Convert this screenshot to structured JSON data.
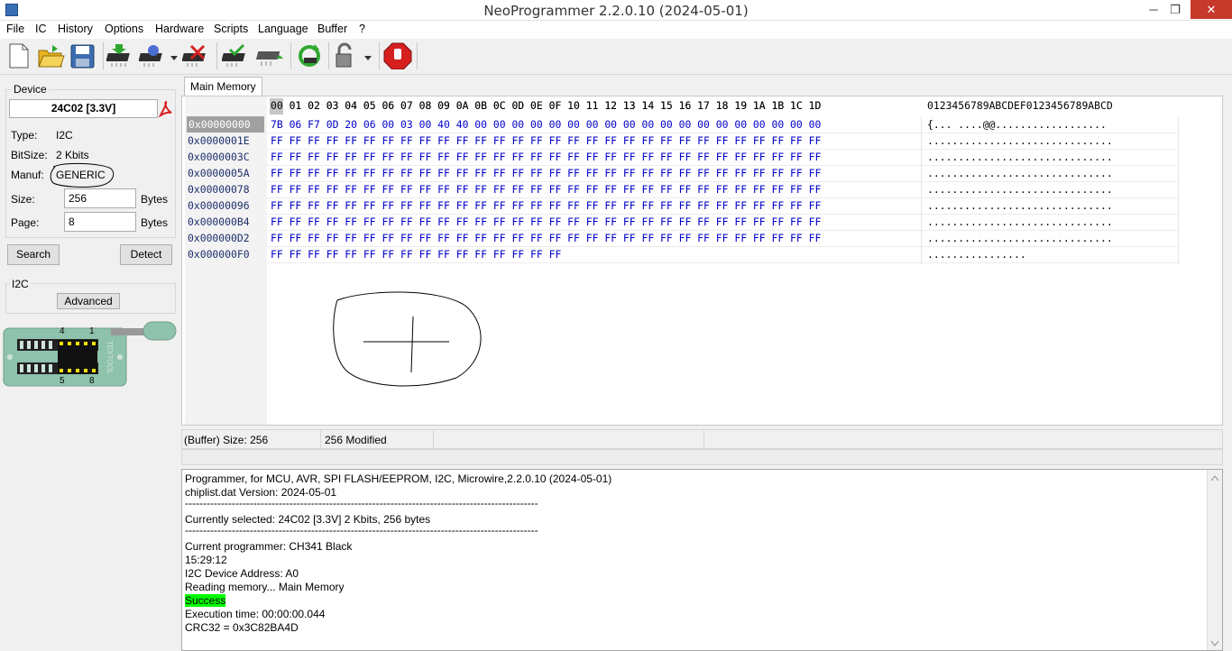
{
  "window": {
    "title": "NeoProgrammer 2.2.0.10 (2024-05-01)",
    "minimize": "─",
    "maximize": "❐",
    "close": "✕"
  },
  "menu": [
    "File",
    "IC",
    "History",
    "Options",
    "Hardware",
    "Scripts",
    "Language",
    "Buffer",
    "?"
  ],
  "toolbar": {
    "icons": [
      "new-file-icon",
      "open-folder-icon",
      "save-icon",
      "read-chip-icon",
      "write-chip-icon",
      "erase-chip-icon",
      "verify-chip-icon",
      "blank-check-icon",
      "auto-icon",
      "lock-icon",
      "stop-icon"
    ]
  },
  "device": {
    "group_title": "Device",
    "name": "24C02 [3.3V]",
    "type_label": "Type:",
    "type_value": "I2C",
    "bitsize_label": "BitSize:",
    "bitsize_value": "2 Kbits",
    "manuf_label": "Manuf:",
    "manuf_value": "GENERIC",
    "size_label": "Size:",
    "size_value": "256",
    "size_unit": "Bytes",
    "page_label": "Page:",
    "page_value": "8",
    "page_unit": "Bytes",
    "search_button": "Search",
    "detect_button": "Detect"
  },
  "i2c": {
    "group_title": "I2C",
    "advanced_button": "Advanced"
  },
  "socket": {
    "pin_top_left": "4",
    "pin_top_right": "1",
    "pin_bottom_left": "5",
    "pin_bottom_right": "8",
    "brand": "TEXTOOL"
  },
  "tabs": [
    "Main Memory"
  ],
  "hex": {
    "header": "00 01 02 03 04 05 06 07 08 09 0A 0B 0C 0D 0E 0F 10 11 12 13 14 15 16 17 18 19 1A 1B 1C 1D",
    "ascii_header": "0123456789ABCDEF0123456789ABCD",
    "rows": [
      {
        "addr": "0x00000000",
        "hex": "7B 06 F7 0D 20 06 00 03 00 40 40 00 00 00 00 00 00 00 00 00 00 00 00 00 00 00 00 00 00 00",
        "ascii": "{... ....@@.................."
      },
      {
        "addr": "0x0000001E",
        "hex": "FF FF FF FF FF FF FF FF FF FF FF FF FF FF FF FF FF FF FF FF FF FF FF FF FF FF FF FF FF FF",
        "ascii": ".............................."
      },
      {
        "addr": "0x0000003C",
        "hex": "FF FF FF FF FF FF FF FF FF FF FF FF FF FF FF FF FF FF FF FF FF FF FF FF FF FF FF FF FF FF",
        "ascii": ".............................."
      },
      {
        "addr": "0x0000005A",
        "hex": "FF FF FF FF FF FF FF FF FF FF FF FF FF FF FF FF FF FF FF FF FF FF FF FF FF FF FF FF FF FF",
        "ascii": ".............................."
      },
      {
        "addr": "0x00000078",
        "hex": "FF FF FF FF FF FF FF FF FF FF FF FF FF FF FF FF FF FF FF FF FF FF FF FF FF FF FF FF FF FF",
        "ascii": ".............................."
      },
      {
        "addr": "0x00000096",
        "hex": "FF FF FF FF FF FF FF FF FF FF FF FF FF FF FF FF FF FF FF FF FF FF FF FF FF FF FF FF FF FF",
        "ascii": ".............................."
      },
      {
        "addr": "0x000000B4",
        "hex": "FF FF FF FF FF FF FF FF FF FF FF FF FF FF FF FF FF FF FF FF FF FF FF FF FF FF FF FF FF FF",
        "ascii": ".............................."
      },
      {
        "addr": "0x000000D2",
        "hex": "FF FF FF FF FF FF FF FF FF FF FF FF FF FF FF FF FF FF FF FF FF FF FF FF FF FF FF FF FF FF",
        "ascii": ".............................."
      },
      {
        "addr": "0x000000F0",
        "hex": "FF FF FF FF FF FF FF FF FF FF FF FF FF FF FF FF",
        "ascii": "................"
      }
    ]
  },
  "status": {
    "buffer_size": "(Buffer) Size: 256",
    "modified": "256 Modified"
  },
  "log": {
    "lines": [
      "Programmer, for MCU, AVR, SPI FLASH/EEPROM, I2C, Microwire,2.2.0.10 (2024-05-01)",
      "chiplist.dat Version: 2024-05-01",
      "--------------------------------------------------------------------------------------------------",
      "Currently selected:  24C02 [3.3V] 2 Kbits, 256 bytes",
      "--------------------------------------------------------------------------------------------------",
      "Current programmer: CH341 Black",
      "15:29:12",
      "I2C Device Address: A0",
      "Reading memory... Main Memory",
      "Success",
      "Execution time: 00:00:00.044",
      "CRC32 = 0x3C82BA4D"
    ]
  },
  "colors": {
    "hex_blue": "#0000c8",
    "success_green": "#00ff00",
    "stop_red": "#d62020",
    "socket_green": "#8fc2ac"
  }
}
